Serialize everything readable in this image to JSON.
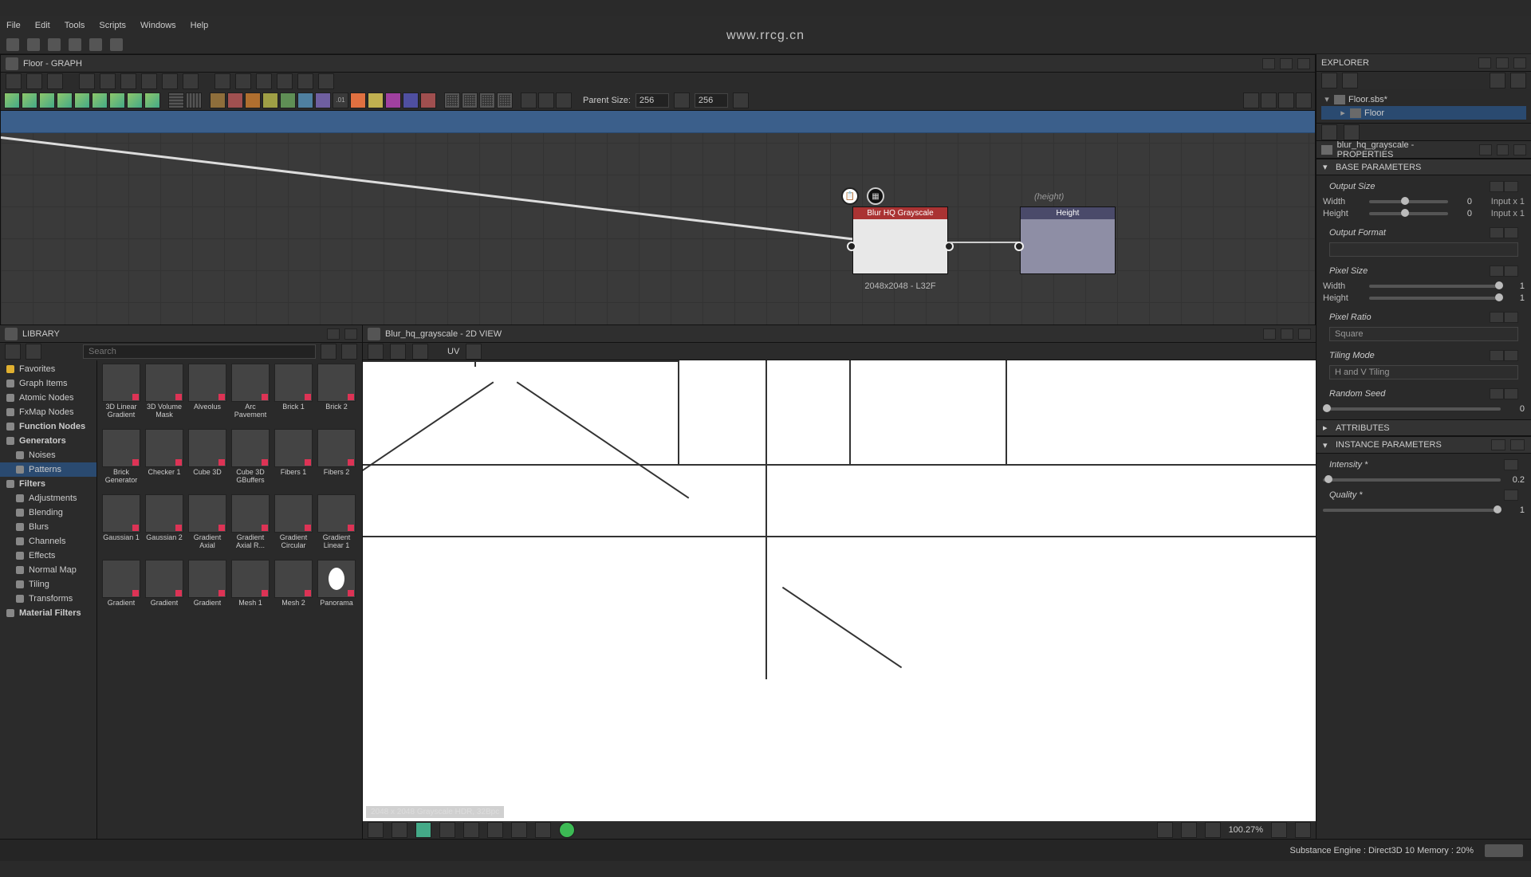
{
  "watermark": "www.rrcg.cn",
  "menu": [
    "File",
    "Edit",
    "Tools",
    "Scripts",
    "Windows",
    "Help"
  ],
  "graph": {
    "title": "Floor - GRAPH",
    "parentSizeLabel": "Parent Size:",
    "parentW": "256",
    "parentH": "256",
    "nodeBlur": {
      "title": "Blur HQ Grayscale",
      "caption": "2048x2048 - L32F"
    },
    "nodeHeight": {
      "title": "Height",
      "topLabel": "(height)"
    }
  },
  "explorer": {
    "title": "EXPLORER",
    "file": "Floor.sbs*",
    "graph": "Floor"
  },
  "props": {
    "title": "blur_hq_grayscale - PROPERTIES",
    "baseHdr": "BASE PARAMETERS",
    "outputSize": "Output Size",
    "width": "Width",
    "height": "Height",
    "wVal": "0",
    "wUnit": "Input x 1",
    "hVal": "0",
    "hUnit": "Input x 1",
    "outputFormat": "Output Format",
    "pixelSize": "Pixel Size",
    "pwVal": "1",
    "phVal": "1",
    "pixelRatio": "Pixel Ratio",
    "pixelRatioVal": "Square",
    "tilingMode": "Tiling Mode",
    "tilingModeVal": "H and V Tiling",
    "randomSeed": "Random Seed",
    "seedVal": "0",
    "attributes": "ATTRIBUTES",
    "instanceHdr": "INSTANCE PARAMETERS",
    "intensity": "Intensity *",
    "intensityVal": "0.2",
    "quality": "Quality *",
    "qualityVal": "1"
  },
  "library": {
    "title": "LIBRARY",
    "searchPH": "Search",
    "tree": [
      {
        "label": "Favorites",
        "cls": "star"
      },
      {
        "label": "Graph Items"
      },
      {
        "label": "Atomic Nodes"
      },
      {
        "label": "FxMap Nodes"
      },
      {
        "label": "Function Nodes",
        "bold": true
      },
      {
        "label": "Generators",
        "bold": true
      },
      {
        "label": "Noises",
        "indent": true
      },
      {
        "label": "Patterns",
        "indent": true,
        "sel": true
      },
      {
        "label": "Filters",
        "bold": true
      },
      {
        "label": "Adjustments",
        "indent": true
      },
      {
        "label": "Blending",
        "indent": true
      },
      {
        "label": "Blurs",
        "indent": true
      },
      {
        "label": "Channels",
        "indent": true
      },
      {
        "label": "Effects",
        "indent": true
      },
      {
        "label": "Normal Map",
        "indent": true
      },
      {
        "label": "Tiling",
        "indent": true
      },
      {
        "label": "Transforms",
        "indent": true
      },
      {
        "label": "Material Filters",
        "bold": true
      }
    ],
    "thumbs": [
      {
        "t": "3D Linear Gradient",
        "c": "tg1"
      },
      {
        "t": "3D Volume Mask",
        "c": "tg2"
      },
      {
        "t": "Alveolus",
        "c": "tg3"
      },
      {
        "t": "Arc Pavement",
        "c": "tg4"
      },
      {
        "t": "Brick 1",
        "c": "tg5"
      },
      {
        "t": "Brick 2",
        "c": "tg6"
      },
      {
        "t": "Brick Generator",
        "c": "tg7"
      },
      {
        "t": "Checker 1",
        "c": "tg9"
      },
      {
        "t": "Cube 3D",
        "c": "tg10"
      },
      {
        "t": "Cube 3D GBuffers",
        "c": "tg11"
      },
      {
        "t": "Fibers 1",
        "c": "tg12"
      },
      {
        "t": "Fibers 2",
        "c": "tg13"
      },
      {
        "t": "Gaussian 1",
        "c": "tg14"
      },
      {
        "t": "Gaussian 2",
        "c": "tg15"
      },
      {
        "t": "Gradient Axial",
        "c": "tg16"
      },
      {
        "t": "Gradient Axial R...",
        "c": "tg17"
      },
      {
        "t": "Gradient Circular",
        "c": "tg18"
      },
      {
        "t": "Gradient Linear 1",
        "c": "tg19"
      },
      {
        "t": "Gradient",
        "c": "tg20"
      },
      {
        "t": "Gradient",
        "c": "tg21"
      },
      {
        "t": "Gradient",
        "c": "tg22"
      },
      {
        "t": "Mesh 1",
        "c": "tg23"
      },
      {
        "t": "Mesh 2",
        "c": "tg24"
      },
      {
        "t": "Panorama",
        "c": "tg25"
      }
    ]
  },
  "view2d": {
    "title": "Blur_hq_grayscale - 2D VIEW",
    "uvLabel": "UV",
    "overlay": "2048 x 2048   Grayscale HDR, 32Bpc",
    "zoom": "100.27%"
  },
  "status": {
    "engine": "Substance Engine : Direct3D 10   Memory : 20%"
  }
}
